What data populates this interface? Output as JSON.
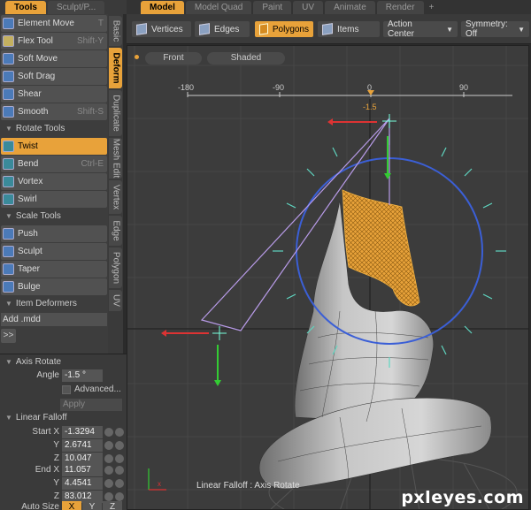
{
  "left_tabs": [
    "Tools",
    "Sculpt/P..."
  ],
  "main_tabs": [
    "Model",
    "Model Quad",
    "Paint",
    "UV",
    "Animate",
    "Render",
    "+"
  ],
  "tools": [
    {
      "label": "Element Move",
      "shortcut": "T",
      "icon": "element-move-icon",
      "color": "#4b7ab8"
    },
    {
      "label": "Flex Tool",
      "shortcut": "Shift-Y",
      "icon": "flex-tool-icon",
      "color": "#c4b060"
    },
    {
      "label": "Soft Move",
      "shortcut": "",
      "icon": "soft-move-icon",
      "color": "#4b7ab8"
    },
    {
      "label": "Soft Drag",
      "shortcut": "",
      "icon": "soft-drag-icon",
      "color": "#4b7ab8"
    },
    {
      "label": "Shear",
      "shortcut": "",
      "icon": "shear-icon",
      "color": "#4b7ab8"
    },
    {
      "label": "Smooth",
      "shortcut": "Shift-S",
      "icon": "smooth-icon",
      "color": "#4b7ab8"
    }
  ],
  "rotate_section": "Rotate Tools",
  "rotate_tools": [
    {
      "label": "Twist",
      "shortcut": "",
      "icon": "twist-icon",
      "color": "#3a8a9a",
      "active": true
    },
    {
      "label": "Bend",
      "shortcut": "Ctrl-E",
      "icon": "bend-icon",
      "color": "#3a8a9a"
    },
    {
      "label": "Vortex",
      "shortcut": "",
      "icon": "vortex-icon",
      "color": "#3a8a9a"
    },
    {
      "label": "Swirl",
      "shortcut": "",
      "icon": "swirl-icon",
      "color": "#3a8a9a"
    }
  ],
  "scale_section": "Scale Tools",
  "scale_tools": [
    {
      "label": "Push",
      "shortcut": "",
      "icon": "push-icon",
      "color": "#4b7ab8"
    },
    {
      "label": "Sculpt",
      "shortcut": "",
      "icon": "sculpt-icon",
      "color": "#4b7ab8"
    },
    {
      "label": "Taper",
      "shortcut": "",
      "icon": "taper-icon",
      "color": "#4b7ab8"
    },
    {
      "label": "Bulge",
      "shortcut": "",
      "icon": "bulge-icon",
      "color": "#4b7ab8"
    }
  ],
  "deformers_section": "Item Deformers",
  "add_mdd": "Add .mdd",
  "expander": ">>",
  "side_tabs": [
    "Basic",
    "Deform",
    "Duplicate",
    "Mesh Edit",
    "Vertex",
    "Edge",
    "Polygon",
    "UV"
  ],
  "props": {
    "axis_rotate": "Axis Rotate",
    "angle_label": "Angle",
    "angle_value": "-1.5 °",
    "advanced": "Advanced...",
    "apply": "Apply",
    "linear_falloff": "Linear Falloff",
    "start_x_label": "Start X",
    "start_x": "-1.3294",
    "start_y_label": "Y",
    "start_y": "2.6741",
    "start_z_label": "Z",
    "start_z": "10.047",
    "end_x_label": "End X",
    "end_x": "11.057",
    "end_y_label": "Y",
    "end_y": "4.4541",
    "end_z_label": "Z",
    "end_z": "83.012",
    "auto_size": "Auto Size",
    "axes": [
      "X",
      "Y",
      "Z"
    ]
  },
  "toolbar": {
    "vertices": "Vertices",
    "edges": "Edges",
    "polygons": "Polygons",
    "items": "Items",
    "action_center": "Action Center",
    "symmetry": "Symmetry: Off"
  },
  "viewport": {
    "view": "Front",
    "shading": "Shaded",
    "ruler": [
      "-180",
      "-90",
      "0",
      "90"
    ],
    "angle_readout": "-1.5",
    "status": "Linear Falloff : Axis Rotate"
  },
  "watermark": "pxleyes.com",
  "colors": {
    "accent": "#e8a23a",
    "circle": "#3b5fd6",
    "falloff": "#b89be8",
    "mesh": "#e8a23a"
  }
}
